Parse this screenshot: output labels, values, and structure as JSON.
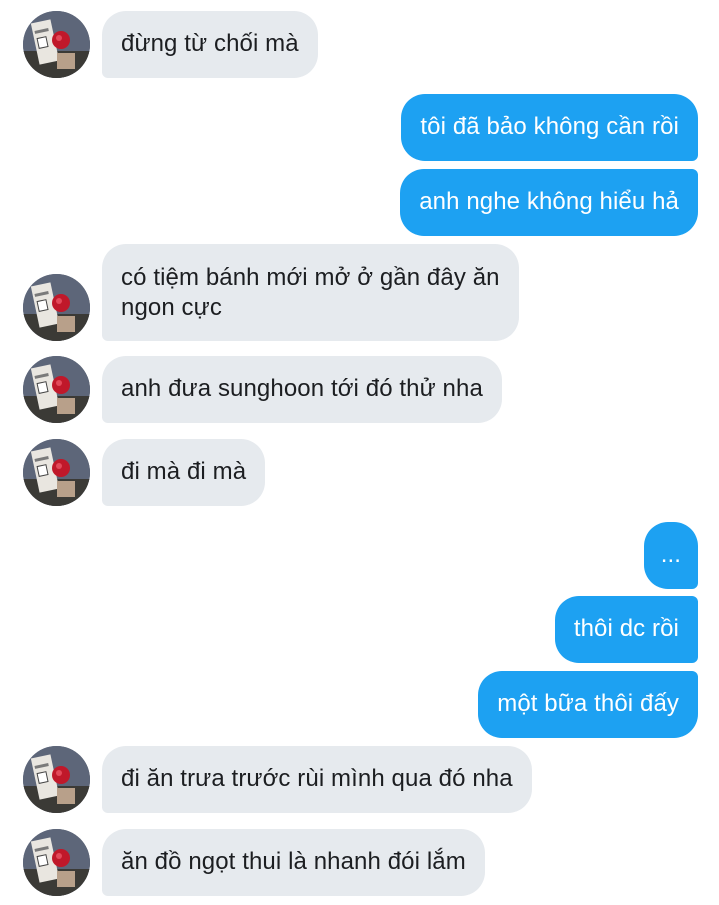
{
  "conversation": {
    "avatar_icon": "avatar-profile-photo-icon",
    "colors": {
      "incoming_bubble": "#e6eaee",
      "incoming_text": "#1c1e21",
      "outgoing_bubble": "#1da1f2",
      "outgoing_text": "#ffffff",
      "background": "#ffffff"
    },
    "messages": [
      {
        "sender": "other",
        "text": "đừng từ chối mà"
      },
      {
        "sender": "me",
        "text": "tôi đã bảo không cần rồi"
      },
      {
        "sender": "me",
        "text": "anh nghe không hiểu hả"
      },
      {
        "sender": "other",
        "text": "có tiệm bánh mới mở ở gần đây ăn\nngon cực"
      },
      {
        "sender": "other",
        "text": "anh đưa sunghoon tới đó thử nha"
      },
      {
        "sender": "other",
        "text": "đi mà đi mà"
      },
      {
        "sender": "me",
        "text": "..."
      },
      {
        "sender": "me",
        "text": "thôi dc rồi"
      },
      {
        "sender": "me",
        "text": "một bữa thôi đấy"
      },
      {
        "sender": "other",
        "text": "đi ăn trưa trước rùi mình qua đó nha"
      },
      {
        "sender": "other",
        "text": "ăn đồ ngọt thui là nhanh đói lắm"
      }
    ]
  }
}
